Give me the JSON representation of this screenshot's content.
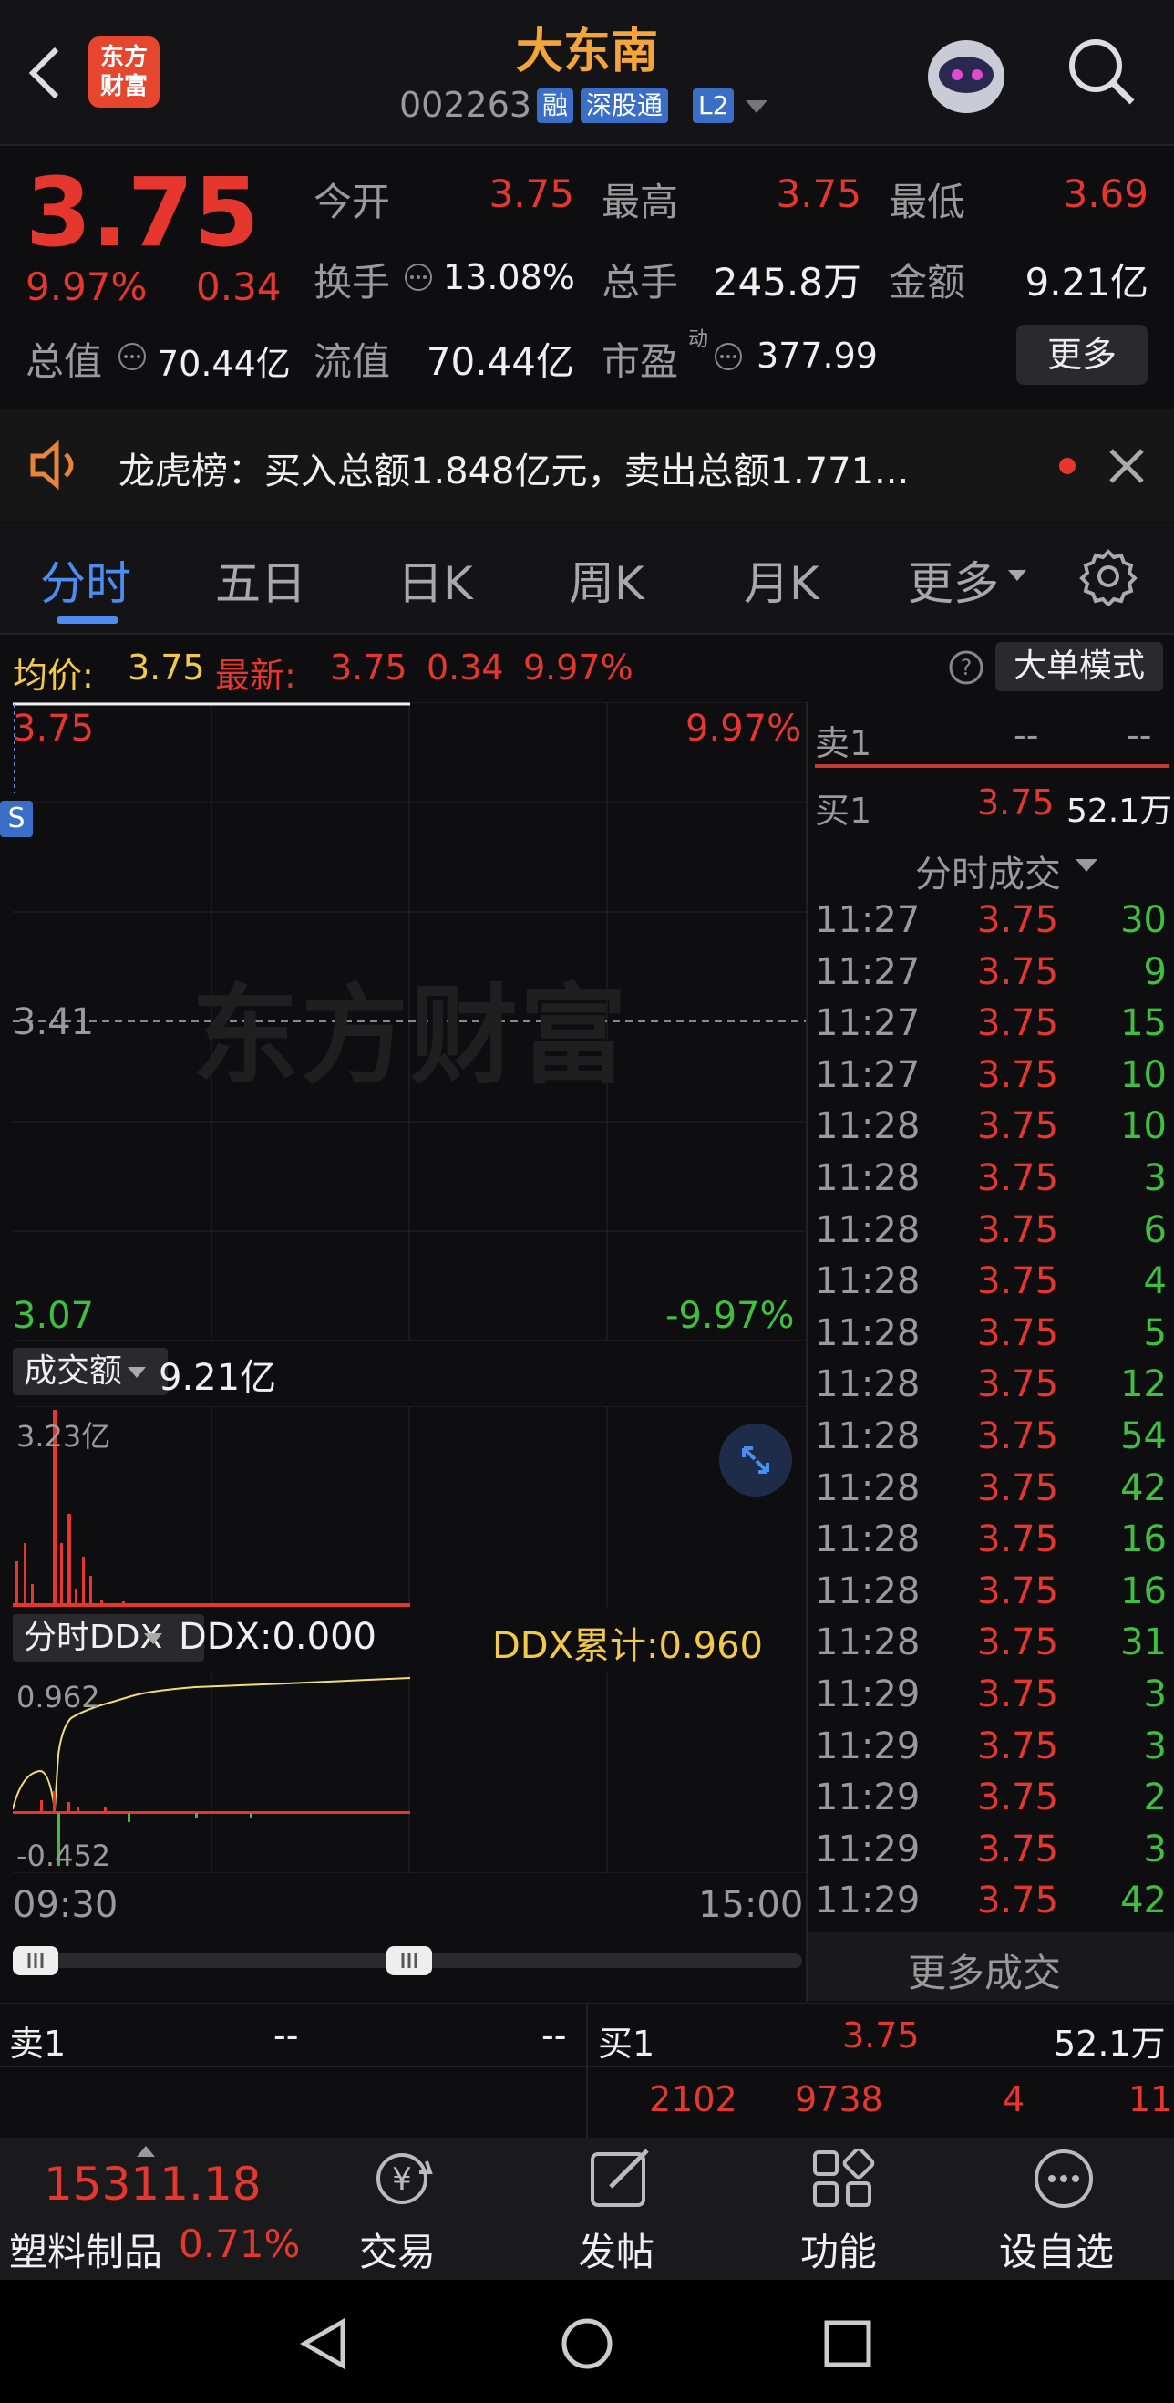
{
  "header": {
    "title": "大东南",
    "code": "002263",
    "badges": [
      "融",
      "深股通",
      "L2"
    ],
    "logo_text_line1": "东方",
    "logo_text_line2": "财富"
  },
  "quote": {
    "price": "3.75",
    "change_pct": "9.97%",
    "change": "0.34",
    "open_label": "今开",
    "open": "3.75",
    "high_label": "最高",
    "high": "3.75",
    "low_label": "最低",
    "low": "3.69",
    "turnover_label": "换手",
    "turnover": "13.08%",
    "volume_label": "总手",
    "volume": "245.8万",
    "amount_label": "金额",
    "amount": "9.21亿",
    "total_value_label": "总值",
    "total_value": "70.44亿",
    "float_value_label": "流值",
    "float_value": "70.44亿",
    "pe_label": "市盈",
    "pe_sup": "动",
    "pe": "377.99",
    "more_label": "更多"
  },
  "notice": {
    "text": "龙虎榜：买入总额1.848亿元，卖出总额1.771..."
  },
  "tabs": [
    "分时",
    "五日",
    "日K",
    "周K",
    "月K",
    "更多"
  ],
  "active_tab": "分时",
  "infobar": {
    "avg_label": "均价:",
    "avg_value": "3.75",
    "latest_label": "最新:",
    "latest_value": "3.75",
    "latest_change": "0.34",
    "latest_pct": "9.97%",
    "big_order_mode": "大单模式"
  },
  "price_chart": {
    "top_price": "3.75",
    "mid_price": "3.41",
    "bottom_price": "3.07",
    "top_pct": "9.97%",
    "bottom_pct": "-9.97%",
    "marker": "S",
    "watermark": "东方财富"
  },
  "volume_chart": {
    "selector_label": "成交额",
    "total": "9.21亿",
    "max_label": "3.23亿"
  },
  "ddx_chart": {
    "selector_label": "分时DDX",
    "ddx": "DDX:0.000",
    "ddx_cum": "DDX累计:0.960",
    "top_label": "0.962",
    "bottom_label": "-0.452"
  },
  "time_axis": {
    "start": "09:30",
    "end": "15:00"
  },
  "order_book": {
    "sell1_label": "卖1",
    "sell1_price": "--",
    "sell1_vol": "--",
    "buy1_label": "买1",
    "buy1_price": "3.75",
    "buy1_vol": "52.1万"
  },
  "trades_header": "分时成交",
  "trades": [
    {
      "time": "11:27",
      "price": "3.75",
      "vol": "30"
    },
    {
      "time": "11:27",
      "price": "3.75",
      "vol": "9"
    },
    {
      "time": "11:27",
      "price": "3.75",
      "vol": "15"
    },
    {
      "time": "11:27",
      "price": "3.75",
      "vol": "10"
    },
    {
      "time": "11:28",
      "price": "3.75",
      "vol": "10"
    },
    {
      "time": "11:28",
      "price": "3.75",
      "vol": "3"
    },
    {
      "time": "11:28",
      "price": "3.75",
      "vol": "6"
    },
    {
      "time": "11:28",
      "price": "3.75",
      "vol": "4"
    },
    {
      "time": "11:28",
      "price": "3.75",
      "vol": "5"
    },
    {
      "time": "11:28",
      "price": "3.75",
      "vol": "12"
    },
    {
      "time": "11:28",
      "price": "3.75",
      "vol": "54"
    },
    {
      "time": "11:28",
      "price": "3.75",
      "vol": "42"
    },
    {
      "time": "11:28",
      "price": "3.75",
      "vol": "16"
    },
    {
      "time": "11:28",
      "price": "3.75",
      "vol": "16"
    },
    {
      "time": "11:28",
      "price": "3.75",
      "vol": "31"
    },
    {
      "time": "11:29",
      "price": "3.75",
      "vol": "3"
    },
    {
      "time": "11:29",
      "price": "3.75",
      "vol": "3"
    },
    {
      "time": "11:29",
      "price": "3.75",
      "vol": "2"
    },
    {
      "time": "11:29",
      "price": "3.75",
      "vol": "3"
    },
    {
      "time": "11:29",
      "price": "3.75",
      "vol": "42"
    }
  ],
  "more_trades": "更多成交",
  "bottom_book": {
    "sell1_label": "卖1",
    "sell1_price": "--",
    "sell1_vol": "--",
    "buy1_label": "买1",
    "buy1_price": "3.75",
    "buy1_vol": "52.1万",
    "counts": [
      "2102",
      "9738",
      "4",
      "11"
    ]
  },
  "bottom_nav": {
    "index_value": "15311.18",
    "index_name": "塑料制品",
    "index_pct": "0.71%",
    "items": [
      "交易",
      "发帖",
      "功能",
      "设自选"
    ]
  },
  "colors": {
    "up": "#e6372e",
    "down": "#3ec03e",
    "accent": "#4b8df2",
    "avg_line": "#f3c94a"
  }
}
